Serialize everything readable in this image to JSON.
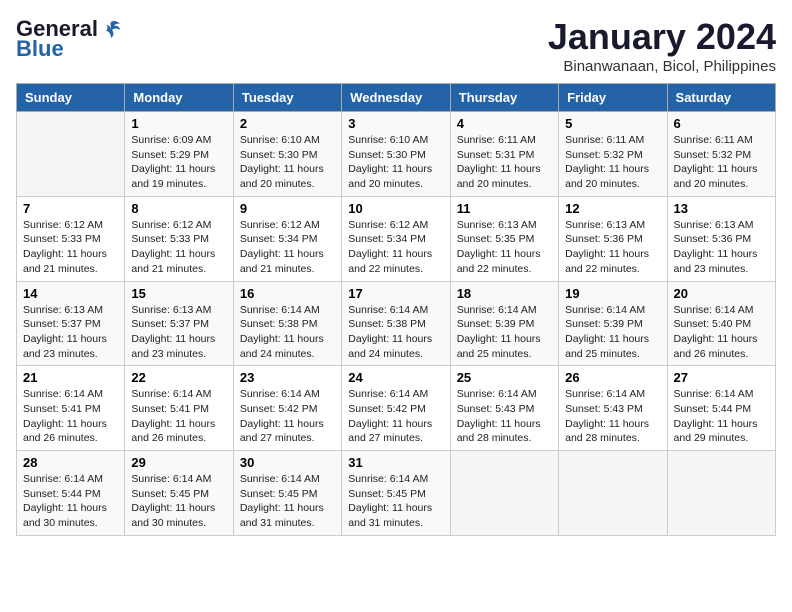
{
  "header": {
    "logo_general": "General",
    "logo_blue": "Blue",
    "month_title": "January 2024",
    "subtitle": "Binanwanaan, Bicol, Philippines"
  },
  "days_of_week": [
    "Sunday",
    "Monday",
    "Tuesday",
    "Wednesday",
    "Thursday",
    "Friday",
    "Saturday"
  ],
  "weeks": [
    [
      {
        "num": "",
        "sunrise": "",
        "sunset": "",
        "daylight": "",
        "empty": true
      },
      {
        "num": "1",
        "sunrise": "Sunrise: 6:09 AM",
        "sunset": "Sunset: 5:29 PM",
        "daylight": "Daylight: 11 hours and 19 minutes."
      },
      {
        "num": "2",
        "sunrise": "Sunrise: 6:10 AM",
        "sunset": "Sunset: 5:30 PM",
        "daylight": "Daylight: 11 hours and 20 minutes."
      },
      {
        "num": "3",
        "sunrise": "Sunrise: 6:10 AM",
        "sunset": "Sunset: 5:30 PM",
        "daylight": "Daylight: 11 hours and 20 minutes."
      },
      {
        "num": "4",
        "sunrise": "Sunrise: 6:11 AM",
        "sunset": "Sunset: 5:31 PM",
        "daylight": "Daylight: 11 hours and 20 minutes."
      },
      {
        "num": "5",
        "sunrise": "Sunrise: 6:11 AM",
        "sunset": "Sunset: 5:32 PM",
        "daylight": "Daylight: 11 hours and 20 minutes."
      },
      {
        "num": "6",
        "sunrise": "Sunrise: 6:11 AM",
        "sunset": "Sunset: 5:32 PM",
        "daylight": "Daylight: 11 hours and 20 minutes."
      }
    ],
    [
      {
        "num": "7",
        "sunrise": "Sunrise: 6:12 AM",
        "sunset": "Sunset: 5:33 PM",
        "daylight": "Daylight: 11 hours and 21 minutes."
      },
      {
        "num": "8",
        "sunrise": "Sunrise: 6:12 AM",
        "sunset": "Sunset: 5:33 PM",
        "daylight": "Daylight: 11 hours and 21 minutes."
      },
      {
        "num": "9",
        "sunrise": "Sunrise: 6:12 AM",
        "sunset": "Sunset: 5:34 PM",
        "daylight": "Daylight: 11 hours and 21 minutes."
      },
      {
        "num": "10",
        "sunrise": "Sunrise: 6:12 AM",
        "sunset": "Sunset: 5:34 PM",
        "daylight": "Daylight: 11 hours and 22 minutes."
      },
      {
        "num": "11",
        "sunrise": "Sunrise: 6:13 AM",
        "sunset": "Sunset: 5:35 PM",
        "daylight": "Daylight: 11 hours and 22 minutes."
      },
      {
        "num": "12",
        "sunrise": "Sunrise: 6:13 AM",
        "sunset": "Sunset: 5:36 PM",
        "daylight": "Daylight: 11 hours and 22 minutes."
      },
      {
        "num": "13",
        "sunrise": "Sunrise: 6:13 AM",
        "sunset": "Sunset: 5:36 PM",
        "daylight": "Daylight: 11 hours and 23 minutes."
      }
    ],
    [
      {
        "num": "14",
        "sunrise": "Sunrise: 6:13 AM",
        "sunset": "Sunset: 5:37 PM",
        "daylight": "Daylight: 11 hours and 23 minutes."
      },
      {
        "num": "15",
        "sunrise": "Sunrise: 6:13 AM",
        "sunset": "Sunset: 5:37 PM",
        "daylight": "Daylight: 11 hours and 23 minutes."
      },
      {
        "num": "16",
        "sunrise": "Sunrise: 6:14 AM",
        "sunset": "Sunset: 5:38 PM",
        "daylight": "Daylight: 11 hours and 24 minutes."
      },
      {
        "num": "17",
        "sunrise": "Sunrise: 6:14 AM",
        "sunset": "Sunset: 5:38 PM",
        "daylight": "Daylight: 11 hours and 24 minutes."
      },
      {
        "num": "18",
        "sunrise": "Sunrise: 6:14 AM",
        "sunset": "Sunset: 5:39 PM",
        "daylight": "Daylight: 11 hours and 25 minutes."
      },
      {
        "num": "19",
        "sunrise": "Sunrise: 6:14 AM",
        "sunset": "Sunset: 5:39 PM",
        "daylight": "Daylight: 11 hours and 25 minutes."
      },
      {
        "num": "20",
        "sunrise": "Sunrise: 6:14 AM",
        "sunset": "Sunset: 5:40 PM",
        "daylight": "Daylight: 11 hours and 26 minutes."
      }
    ],
    [
      {
        "num": "21",
        "sunrise": "Sunrise: 6:14 AM",
        "sunset": "Sunset: 5:41 PM",
        "daylight": "Daylight: 11 hours and 26 minutes."
      },
      {
        "num": "22",
        "sunrise": "Sunrise: 6:14 AM",
        "sunset": "Sunset: 5:41 PM",
        "daylight": "Daylight: 11 hours and 26 minutes."
      },
      {
        "num": "23",
        "sunrise": "Sunrise: 6:14 AM",
        "sunset": "Sunset: 5:42 PM",
        "daylight": "Daylight: 11 hours and 27 minutes."
      },
      {
        "num": "24",
        "sunrise": "Sunrise: 6:14 AM",
        "sunset": "Sunset: 5:42 PM",
        "daylight": "Daylight: 11 hours and 27 minutes."
      },
      {
        "num": "25",
        "sunrise": "Sunrise: 6:14 AM",
        "sunset": "Sunset: 5:43 PM",
        "daylight": "Daylight: 11 hours and 28 minutes."
      },
      {
        "num": "26",
        "sunrise": "Sunrise: 6:14 AM",
        "sunset": "Sunset: 5:43 PM",
        "daylight": "Daylight: 11 hours and 28 minutes."
      },
      {
        "num": "27",
        "sunrise": "Sunrise: 6:14 AM",
        "sunset": "Sunset: 5:44 PM",
        "daylight": "Daylight: 11 hours and 29 minutes."
      }
    ],
    [
      {
        "num": "28",
        "sunrise": "Sunrise: 6:14 AM",
        "sunset": "Sunset: 5:44 PM",
        "daylight": "Daylight: 11 hours and 30 minutes."
      },
      {
        "num": "29",
        "sunrise": "Sunrise: 6:14 AM",
        "sunset": "Sunset: 5:45 PM",
        "daylight": "Daylight: 11 hours and 30 minutes."
      },
      {
        "num": "30",
        "sunrise": "Sunrise: 6:14 AM",
        "sunset": "Sunset: 5:45 PM",
        "daylight": "Daylight: 11 hours and 31 minutes."
      },
      {
        "num": "31",
        "sunrise": "Sunrise: 6:14 AM",
        "sunset": "Sunset: 5:45 PM",
        "daylight": "Daylight: 11 hours and 31 minutes."
      },
      {
        "num": "",
        "sunrise": "",
        "sunset": "",
        "daylight": "",
        "empty": true
      },
      {
        "num": "",
        "sunrise": "",
        "sunset": "",
        "daylight": "",
        "empty": true
      },
      {
        "num": "",
        "sunrise": "",
        "sunset": "",
        "daylight": "",
        "empty": true
      }
    ]
  ]
}
